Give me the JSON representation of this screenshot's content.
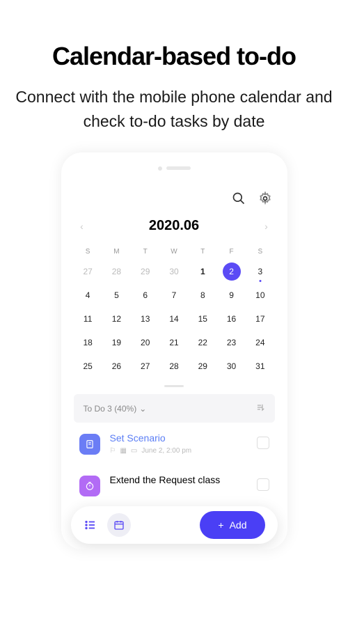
{
  "heading": "Calendar-based to-do",
  "subheading": "Connect with the mobile phone calendar and check to-do tasks by date",
  "month": "2020.06",
  "weekdays": [
    "S",
    "M",
    "T",
    "W",
    "T",
    "F",
    "S"
  ],
  "weeks": [
    [
      {
        "d": "27",
        "muted": true
      },
      {
        "d": "28",
        "muted": true
      },
      {
        "d": "29",
        "muted": true
      },
      {
        "d": "30",
        "muted": true
      },
      {
        "d": "1",
        "bold": true
      },
      {
        "d": "2",
        "selected": true
      },
      {
        "d": "3",
        "dot": true
      }
    ],
    [
      {
        "d": "4"
      },
      {
        "d": "5"
      },
      {
        "d": "6"
      },
      {
        "d": "7"
      },
      {
        "d": "8"
      },
      {
        "d": "9"
      },
      {
        "d": "10"
      }
    ],
    [
      {
        "d": "11"
      },
      {
        "d": "12"
      },
      {
        "d": "13"
      },
      {
        "d": "14"
      },
      {
        "d": "15"
      },
      {
        "d": "16"
      },
      {
        "d": "17"
      }
    ],
    [
      {
        "d": "18"
      },
      {
        "d": "19"
      },
      {
        "d": "20"
      },
      {
        "d": "21"
      },
      {
        "d": "22"
      },
      {
        "d": "23"
      },
      {
        "d": "24"
      }
    ],
    [
      {
        "d": "25"
      },
      {
        "d": "26"
      },
      {
        "d": "27"
      },
      {
        "d": "28"
      },
      {
        "d": "29"
      },
      {
        "d": "30"
      },
      {
        "d": "31"
      }
    ]
  ],
  "todo_header": "To Do 3 (40%)",
  "tasks": [
    {
      "title": "Set Scenario",
      "meta": "June 2, 2:00 pm",
      "icon": "blue",
      "link": true
    },
    {
      "title": "Extend the Request class",
      "meta": "",
      "icon": "purple",
      "link": false
    }
  ],
  "add_label": "Add"
}
